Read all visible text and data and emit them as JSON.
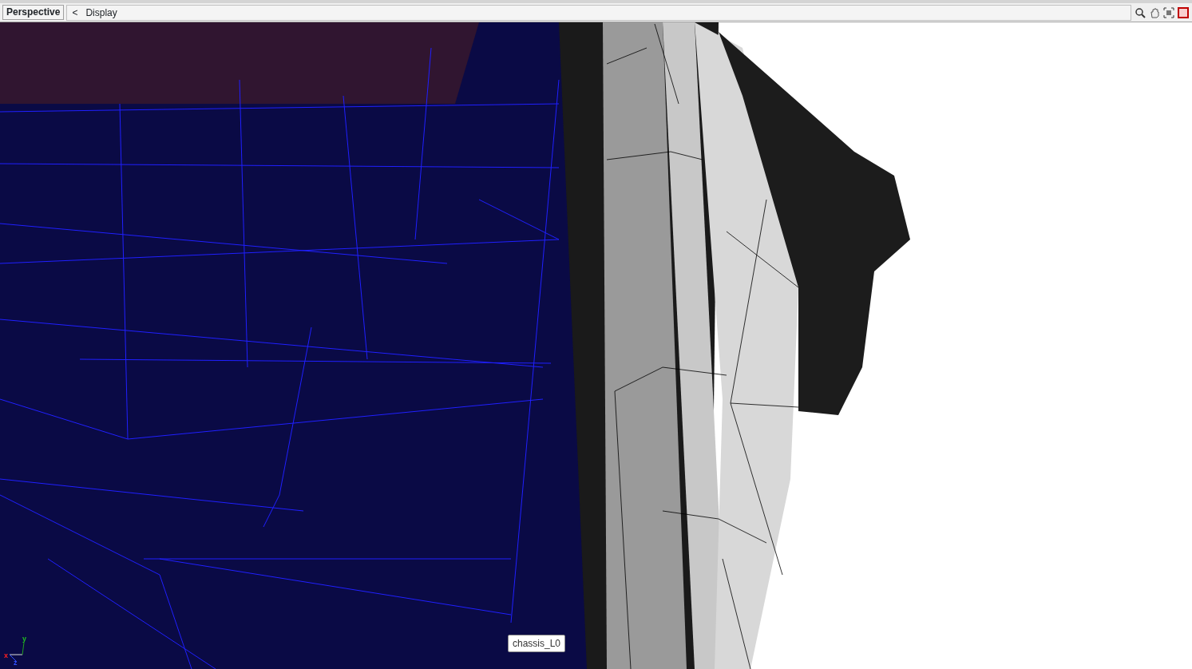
{
  "toolbar": {
    "view_button": "Perspective",
    "back_glyph": "<",
    "menu": "Display",
    "tools": [
      {
        "kind": "zoom"
      },
      {
        "kind": "pan"
      },
      {
        "kind": "frame"
      },
      {
        "kind": "maximize"
      }
    ]
  },
  "viewport": {
    "axes": {
      "y": "y",
      "x": "x",
      "z": "z"
    },
    "tooltip": "chassis_L0"
  }
}
